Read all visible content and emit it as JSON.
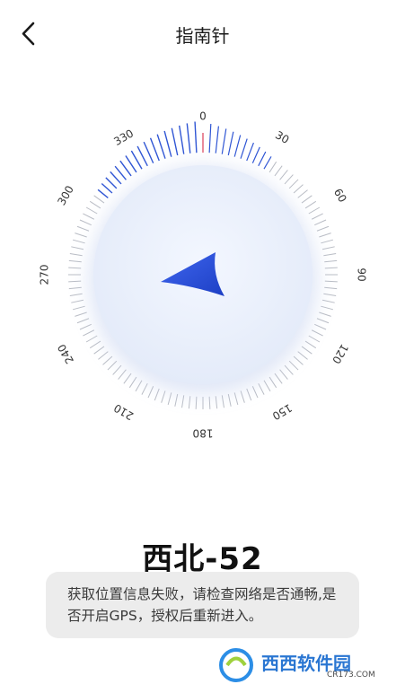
{
  "app": {
    "title": "指南针"
  },
  "compass": {
    "heading_text": "西北-52",
    "heading_degrees": 308,
    "tick_labels": [
      "0",
      "30",
      "60",
      "90",
      "120",
      "150",
      "180",
      "210",
      "240",
      "270",
      "300",
      "330"
    ],
    "colors": {
      "arrow": "#2a4fd8",
      "active_tick": "#2f55d4",
      "north_marker": "#e98a9a",
      "tick": "#b9bcc4"
    }
  },
  "toast": {
    "message": "获取位置信息失败，请检查网络是否通畅,是否开启GPS，授权后重新进入。"
  },
  "watermark": {
    "brand": "西西软件园",
    "url": "CR173.COM",
    "icon": "cr-logo-icon"
  }
}
